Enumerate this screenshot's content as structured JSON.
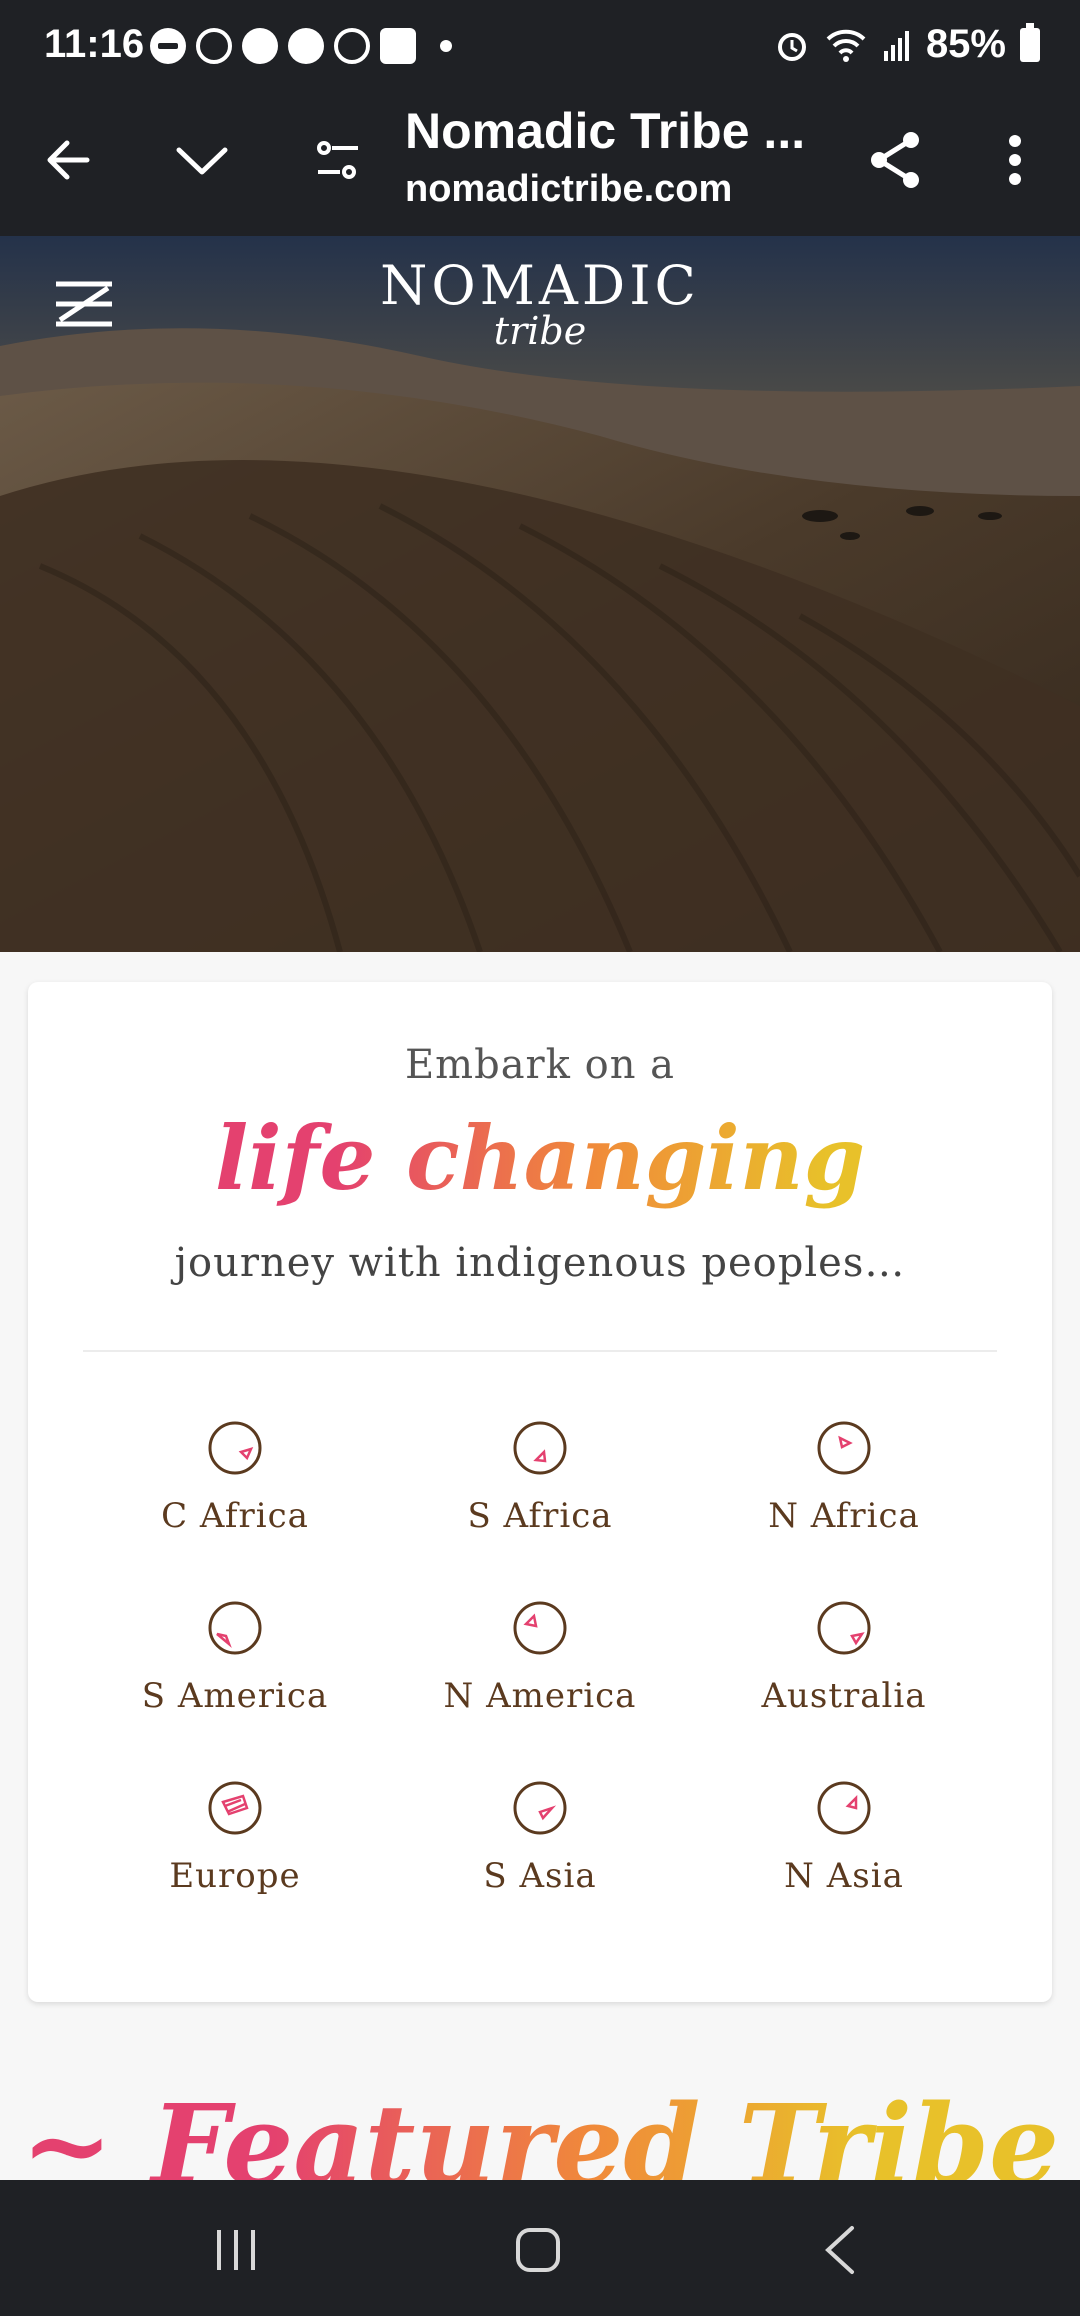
{
  "status_bar": {
    "time": "11:16",
    "battery": "85%"
  },
  "browser": {
    "title": "Nomadic Tribe ...",
    "url": "nomadictribe.com"
  },
  "hero": {
    "logo_main": "NOMADIC",
    "logo_sub": "tribe"
  },
  "intro": {
    "line1": "Embark on a",
    "highlight": "life changing",
    "line3": "journey with indigenous peoples…"
  },
  "regions": [
    {
      "label": "C Africa",
      "icon": "africa-map-icon"
    },
    {
      "label": "S Africa",
      "icon": "africa-map-icon"
    },
    {
      "label": "N Africa",
      "icon": "africa-map-icon"
    },
    {
      "label": "S America",
      "icon": "americas-map-icon"
    },
    {
      "label": "N America",
      "icon": "americas-map-icon"
    },
    {
      "label": "Australia",
      "icon": "australia-map-icon"
    },
    {
      "label": "Europe",
      "icon": "europe-map-icon"
    },
    {
      "label": "S Asia",
      "icon": "asia-map-icon"
    },
    {
      "label": "N Asia",
      "icon": "asia-map-icon"
    }
  ],
  "featured": {
    "heading": "~ Featured Tribe ~"
  },
  "colors": {
    "accent_pink": "#e4416f",
    "accent_orange": "#f08a3a",
    "accent_yellow": "#e8c12a",
    "region_brown": "#5b3a1f",
    "bar_dark": "#1f2125"
  }
}
